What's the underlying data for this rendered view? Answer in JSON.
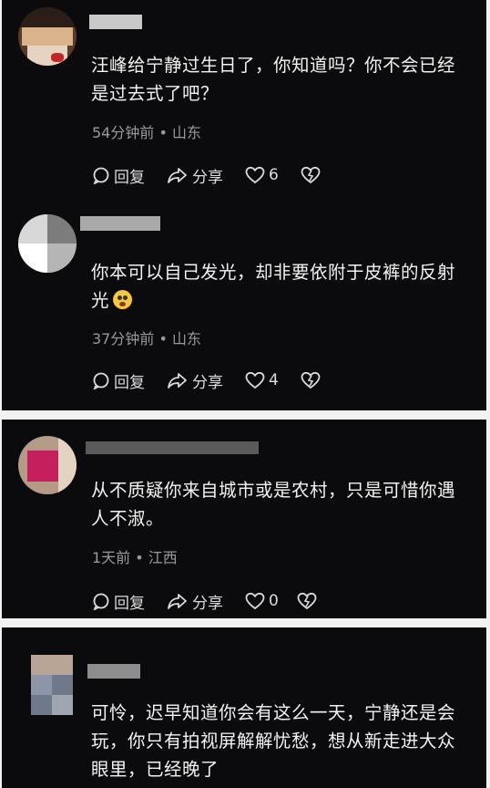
{
  "comments": [
    {
      "text": "汪峰给宁静过生日了，你知道吗？你不会已经是过去式了吧？",
      "meta": "54分钟前 • 山东",
      "reply_label": "回复",
      "share_label": "分享",
      "likes": "6"
    },
    {
      "text": "你本可以自己发光，却非要依附于皮裤的反射光",
      "emoji": "flushed-face-emoji",
      "meta": "37分钟前 • 山东",
      "reply_label": "回复",
      "share_label": "分享",
      "likes": "4"
    },
    {
      "text": "从不质疑你来自城市或是农村，只是可惜你遇人不淑。",
      "meta": "1天前 • 江西",
      "reply_label": "回复",
      "share_label": "分享",
      "likes": "0"
    },
    {
      "text": "可怜，迟早知道你会有这么一天，宁静还是会玩，你只有拍视屏解解忧愁，想从新走进大众眼里，已经晚了"
    }
  ],
  "icons": {
    "reply": "comment-bubble-icon",
    "share": "share-arrow-icon",
    "like": "heart-icon",
    "dislike": "broken-heart-icon"
  },
  "colors": {
    "card_bg": "#0b0b0d",
    "text": "#f3f3f3",
    "meta": "#9a9a9e",
    "page_bg": "#f2f2f2"
  }
}
